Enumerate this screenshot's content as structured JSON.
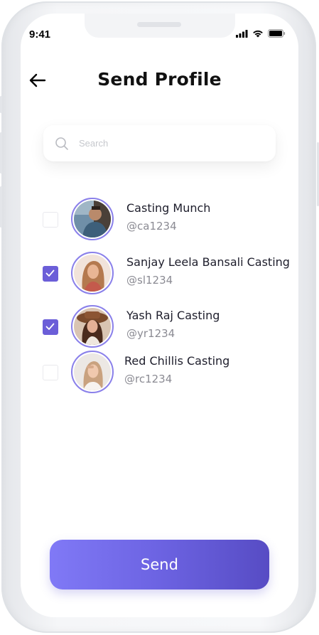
{
  "status_bar": {
    "time": "9:41"
  },
  "header": {
    "title": "Send Profile"
  },
  "search": {
    "placeholder": "Search",
    "value": ""
  },
  "contacts": [
    {
      "name": "Casting Munch",
      "handle": "@ca1234",
      "checked": false
    },
    {
      "name": "Sanjay Leela Bansali Casting",
      "handle": "@sl1234",
      "checked": true
    },
    {
      "name": "Yash Raj Casting",
      "handle": "@yr1234",
      "checked": true
    },
    {
      "name": "Red Chillis Casting",
      "handle": "@rc1234",
      "checked": false
    }
  ],
  "send_button": {
    "label": "Send"
  },
  "colors": {
    "accent": "#6b5ed8",
    "avatar_ring": "#8a80ea",
    "button_gradient_start": "#8079f6",
    "button_gradient_end": "#574cc4"
  },
  "icons": [
    "back-arrow-icon",
    "search-icon",
    "checkmark-icon",
    "signal-icon",
    "wifi-icon",
    "battery-icon"
  ]
}
